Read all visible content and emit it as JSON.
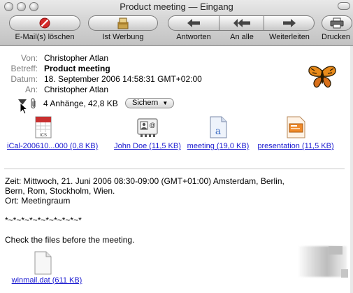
{
  "window": {
    "title": "Product meeting — Eingang"
  },
  "toolbar": {
    "items": [
      {
        "label": "E-Mail(s) löschen",
        "icon": "delete-icon"
      },
      {
        "label": "Ist Werbung",
        "icon": "junk-icon"
      },
      {
        "label": "Antworten",
        "icon": "reply-icon"
      },
      {
        "label": "An alle",
        "icon": "reply-all-icon"
      },
      {
        "label": "Weiterleiten",
        "icon": "forward-icon"
      },
      {
        "label": "Drucken",
        "icon": "printer-icon"
      }
    ]
  },
  "header": {
    "from_label": "Von:",
    "from": "Christopher Atlan",
    "subject_label": "Betreff:",
    "subject": "Product meeting",
    "date_label": "Datum:",
    "date": "18. September 2006 14:58:31 GMT+02:00",
    "to_label": "An:",
    "to": "Christopher Atlan",
    "attachments_summary": "4 Anhänge, 42,8 KB",
    "save_label": "Sichern"
  },
  "attachments": [
    {
      "name": "iCal-200610...000 (0,8 KB)",
      "icon": "ics-file-icon",
      "icon_text": "ICS"
    },
    {
      "name": "John Doe (11,5 KB)",
      "icon": "vcard-file-icon"
    },
    {
      "name": "meeting (19,0 KB)",
      "icon": "text-document-icon"
    },
    {
      "name": "presentation (11,5 KB)",
      "icon": "presentation-file-icon"
    }
  ],
  "body": {
    "lines": [
      "Zeit: Mittwoch, 21. Juni 2006 08:30-09:00 (GMT+01:00) Amsterdam, Berlin,",
      "Bern, Rom, Stockholm, Wien.",
      "Ort: Meetingraum",
      "",
      "*~*~*~*~*~*~*~*~*~*",
      "",
      "Check the files before the meeting."
    ]
  },
  "inline_attachment": {
    "name": "winmail.dat (611 KB)",
    "icon": "generic-file-icon"
  },
  "colors": {
    "link": "#1a1ad0",
    "label_gray": "#7d7d7d",
    "delete_red": "#d42a2a"
  }
}
